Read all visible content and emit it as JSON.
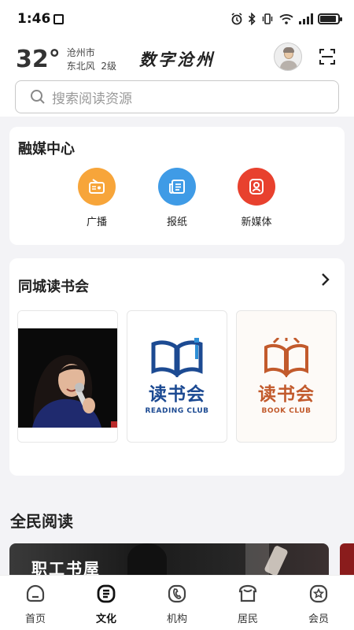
{
  "status": {
    "time": "1:46",
    "battery_level": 0.9
  },
  "header": {
    "temperature": "32°",
    "city": "沧州市",
    "wind": "东北风  2级",
    "brand": "数字沧州"
  },
  "search": {
    "placeholder": "搜索阅读资源"
  },
  "media_center": {
    "title": "融媒中心",
    "items": [
      {
        "label": "广播",
        "icon": "radio-icon",
        "color": "#f7a53a"
      },
      {
        "label": "报纸",
        "icon": "newspaper-icon",
        "color": "#3f9be6"
      },
      {
        "label": "新媒体",
        "icon": "new-media-icon",
        "color": "#e8412e"
      }
    ]
  },
  "reading_club": {
    "title": "同城读书会",
    "cards": [
      {
        "kind": "photo",
        "icon": "speaker-photo"
      },
      {
        "kind": "logo",
        "cn": "读书会",
        "en": "READING CLUB",
        "color": "#1c4a92"
      },
      {
        "kind": "logo",
        "cn": "读书会",
        "en": "BOOK CLUB",
        "color": "#c25a2c"
      }
    ]
  },
  "national_reading": {
    "title": "全民阅读",
    "banner_text": "职工书屋"
  },
  "bottom_nav": {
    "items": [
      {
        "label": "首页",
        "icon": "home-icon",
        "active": false
      },
      {
        "label": "文化",
        "icon": "culture-icon",
        "active": true
      },
      {
        "label": "机构",
        "icon": "institution-icon",
        "active": false
      },
      {
        "label": "居民",
        "icon": "resident-icon",
        "active": false
      },
      {
        "label": "会员",
        "icon": "member-icon",
        "active": false
      }
    ]
  }
}
